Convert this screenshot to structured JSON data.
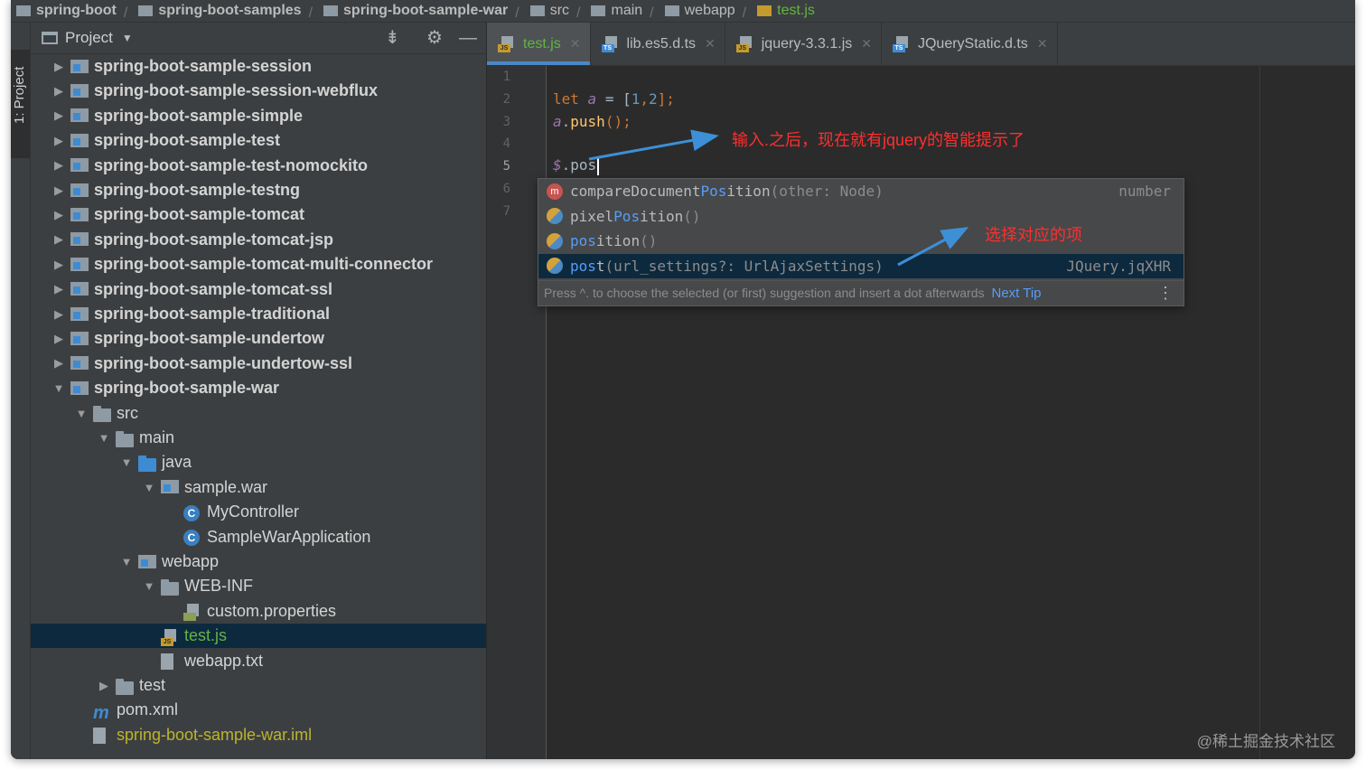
{
  "breadcrumb": [
    {
      "label": "spring-boot",
      "kind": "module"
    },
    {
      "label": "spring-boot-samples",
      "kind": "module"
    },
    {
      "label": "spring-boot-sample-war",
      "kind": "module"
    },
    {
      "label": "src",
      "kind": "folder"
    },
    {
      "label": "main",
      "kind": "folder"
    },
    {
      "label": "webapp",
      "kind": "folder"
    },
    {
      "label": "test.js",
      "kind": "js-file"
    }
  ],
  "side_stripe": {
    "label": "1: Project"
  },
  "project_panel": {
    "title": "Project",
    "tree": [
      {
        "label": "spring-boot-sample-session",
        "depth": 0,
        "arrow": "right",
        "icon": "module-folder-icon",
        "style": "bold"
      },
      {
        "label": "spring-boot-sample-session-webflux",
        "depth": 0,
        "arrow": "right",
        "icon": "module-folder-icon",
        "style": "bold"
      },
      {
        "label": "spring-boot-sample-simple",
        "depth": 0,
        "arrow": "right",
        "icon": "module-folder-icon",
        "style": "bold"
      },
      {
        "label": "spring-boot-sample-test",
        "depth": 0,
        "arrow": "right",
        "icon": "module-folder-icon",
        "style": "bold"
      },
      {
        "label": "spring-boot-sample-test-nomockito",
        "depth": 0,
        "arrow": "right",
        "icon": "module-folder-icon",
        "style": "bold"
      },
      {
        "label": "spring-boot-sample-testng",
        "depth": 0,
        "arrow": "right",
        "icon": "module-folder-icon",
        "style": "bold"
      },
      {
        "label": "spring-boot-sample-tomcat",
        "depth": 0,
        "arrow": "right",
        "icon": "module-folder-icon",
        "style": "bold"
      },
      {
        "label": "spring-boot-sample-tomcat-jsp",
        "depth": 0,
        "arrow": "right",
        "icon": "module-folder-icon",
        "style": "bold"
      },
      {
        "label": "spring-boot-sample-tomcat-multi-connector",
        "depth": 0,
        "arrow": "right",
        "icon": "module-folder-icon",
        "style": "bold"
      },
      {
        "label": "spring-boot-sample-tomcat-ssl",
        "depth": 0,
        "arrow": "right",
        "icon": "module-folder-icon",
        "style": "bold"
      },
      {
        "label": "spring-boot-sample-traditional",
        "depth": 0,
        "arrow": "right",
        "icon": "module-folder-icon",
        "style": "bold"
      },
      {
        "label": "spring-boot-sample-undertow",
        "depth": 0,
        "arrow": "right",
        "icon": "module-folder-icon",
        "style": "bold"
      },
      {
        "label": "spring-boot-sample-undertow-ssl",
        "depth": 0,
        "arrow": "right",
        "icon": "module-folder-icon",
        "style": "bold"
      },
      {
        "label": "spring-boot-sample-war",
        "depth": 0,
        "arrow": "down",
        "icon": "module-folder-icon",
        "style": "bold"
      },
      {
        "label": "src",
        "depth": 1,
        "arrow": "down",
        "icon": "folder-icon",
        "style": ""
      },
      {
        "label": "main",
        "depth": 2,
        "arrow": "down",
        "icon": "folder-icon",
        "style": ""
      },
      {
        "label": "java",
        "depth": 3,
        "arrow": "down",
        "icon": "source-folder-icon",
        "style": ""
      },
      {
        "label": "sample.war",
        "depth": 4,
        "arrow": "down",
        "icon": "package-icon",
        "style": ""
      },
      {
        "label": "MyController",
        "depth": 5,
        "arrow": "",
        "icon": "class-icon",
        "style": ""
      },
      {
        "label": "SampleWarApplication",
        "depth": 5,
        "arrow": "",
        "icon": "class-icon",
        "style": ""
      },
      {
        "label": "webapp",
        "depth": 3,
        "arrow": "down",
        "icon": "web-folder-icon",
        "style": ""
      },
      {
        "label": "WEB-INF",
        "depth": 4,
        "arrow": "down",
        "icon": "folder-icon",
        "style": ""
      },
      {
        "label": "custom.properties",
        "depth": 5,
        "arrow": "",
        "icon": "properties-file-icon",
        "style": ""
      },
      {
        "label": "test.js",
        "depth": 4,
        "arrow": "",
        "icon": "js-file-icon",
        "style": "green",
        "selected": true
      },
      {
        "label": "webapp.txt",
        "depth": 4,
        "arrow": "",
        "icon": "text-file-icon",
        "style": ""
      },
      {
        "label": "test",
        "depth": 2,
        "arrow": "right",
        "icon": "folder-icon",
        "style": ""
      },
      {
        "label": "pom.xml",
        "depth": 1,
        "arrow": "",
        "icon": "maven-icon",
        "style": ""
      },
      {
        "label": "spring-boot-sample-war.iml",
        "depth": 1,
        "arrow": "",
        "icon": "iml-file-icon",
        "style": "yellow"
      }
    ]
  },
  "tabs": [
    {
      "label": "test.js",
      "badge": "JS",
      "active": true
    },
    {
      "label": "lib.es5.d.ts",
      "badge": "TS",
      "active": false
    },
    {
      "label": "jquery-3.3.1.js",
      "badge": "JS",
      "active": false
    },
    {
      "label": "JQueryStatic.d.ts",
      "badge": "TS",
      "active": false
    }
  ],
  "editor": {
    "line_numbers": [
      "1",
      "2",
      "3",
      "4",
      "5",
      "6",
      "7"
    ],
    "current_line": "5",
    "code": {
      "l2_kw": "let",
      "l2_var": "a",
      "l2_eq": " = [",
      "l2_n1": "1",
      "l2_comma": ",",
      "l2_n2": "2",
      "l2_end": "];",
      "l3_var": "a",
      "l3_dot": ".",
      "l3_fn": "push",
      "l3_end": "();",
      "l5_dollar": "$",
      "l5_rest": ".pos"
    }
  },
  "completion": {
    "items": [
      {
        "icon": "m",
        "pre": "compareDocument",
        "hl": "Pos",
        "post": "ition",
        "params": "(other: Node)",
        "type": "number"
      },
      {
        "icon": "p",
        "pre": "pixel",
        "hl": "Pos",
        "post": "ition",
        "params": "()",
        "type": ""
      },
      {
        "icon": "p",
        "pre": "",
        "hl": "pos",
        "post": "ition",
        "params": "()",
        "type": ""
      },
      {
        "icon": "p",
        "pre": "",
        "hl": "pos",
        "post": "t",
        "params": "(url_settings?: UrlAjaxSettings)",
        "type": "JQuery.jqXHR",
        "selected": true
      }
    ],
    "hint": "Press ^. to choose the selected (or first) suggestion and insert a dot afterwards",
    "next_tip": "Next Tip"
  },
  "annotations": {
    "note1": "输入.之后，现在就有jquery的智能提示了",
    "note2": "选择对应的项",
    "color": "#ff2e2e",
    "arrow_color": "#3d8fd6"
  },
  "watermark": "@稀土掘金技术社区"
}
